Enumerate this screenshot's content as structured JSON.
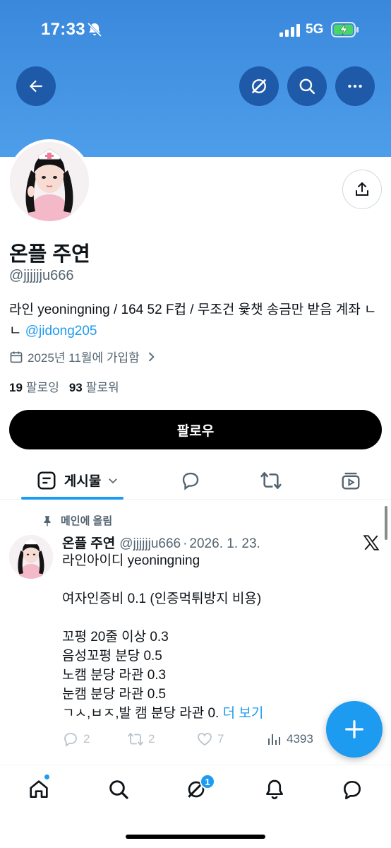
{
  "status_bar": {
    "time": "17:33",
    "network": "5G"
  },
  "profile": {
    "display_name": "온플 주연",
    "handle": "@jjjjjju666",
    "bio_text": "라인 yeoningning / 164 52 F컵 / 무조건 윷챗 송금만 받음 계좌 ㄴㄴ ",
    "bio_mention": "@jidong205",
    "joined": "2025년 11월에 가입함",
    "following_count": "19",
    "following_label": "팔로잉",
    "followers_count": "93",
    "followers_label": "팔로워",
    "follow_button": "팔로우"
  },
  "tabs": {
    "posts_label": "게시물"
  },
  "pinned_post": {
    "pinned_label": "메인에 올림",
    "author_name": "온플 주연",
    "author_handle": "@jjjjjju666",
    "separator": "·",
    "date": "2026. 1. 23.",
    "lines": [
      "라인아이디 yeoningning",
      "",
      "여자인증비 0.1 (인증먹튀방지 비용)",
      "",
      "꼬평 20줄 이상 0.3",
      "음성꼬평 분당  0.5",
      "노캠 분당 라관 0.3",
      "눈캠 분당 라관 0.5",
      "ㄱㅅ,ㅂㅈ,발 캠 분당 라관 0."
    ],
    "more_link": "더 보기",
    "replies": "2",
    "reposts": "2",
    "likes": "7",
    "views": "4393"
  },
  "bottom_nav": {
    "grok_badge": "1"
  },
  "colors": {
    "banner": "#4d9eea",
    "accent": "#1d9bf0",
    "follow_button": "#000000",
    "icon_button": "#1f5aa8"
  },
  "icons": [
    "back-arrow-icon",
    "sync-icon",
    "search-icon",
    "more-icon",
    "share-icon",
    "calendar-icon",
    "chevron-right-icon",
    "pin-icon",
    "x-logo-icon",
    "reply-icon",
    "repost-icon",
    "like-icon",
    "views-icon",
    "compose-plus-icon",
    "home-icon",
    "grok-icon",
    "notifications-icon",
    "messages-icon"
  ]
}
